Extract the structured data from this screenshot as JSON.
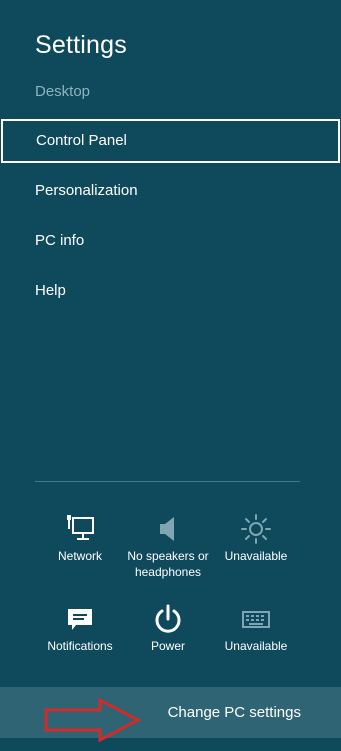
{
  "header": {
    "title": "Settings",
    "context": "Desktop"
  },
  "menu": {
    "items": [
      {
        "label": "Control Panel",
        "selected": true
      },
      {
        "label": "Personalization",
        "selected": false
      },
      {
        "label": "PC info",
        "selected": false
      },
      {
        "label": "Help",
        "selected": false
      }
    ]
  },
  "quick_settings": {
    "row1": [
      {
        "label": "Network",
        "icon": "network-icon"
      },
      {
        "label": "No speakers or headphones",
        "icon": "speaker-icon"
      },
      {
        "label": "Unavailable",
        "icon": "brightness-icon"
      }
    ],
    "row2": [
      {
        "label": "Notifications",
        "icon": "notifications-icon"
      },
      {
        "label": "Power",
        "icon": "power-icon"
      },
      {
        "label": "Unavailable",
        "icon": "keyboard-icon"
      }
    ]
  },
  "footer": {
    "change_pc_settings": "Change PC settings"
  },
  "colors": {
    "background": "#0f4a5c",
    "footer_bar": "#2f6474",
    "annotation_arrow": "#d42a2a"
  }
}
